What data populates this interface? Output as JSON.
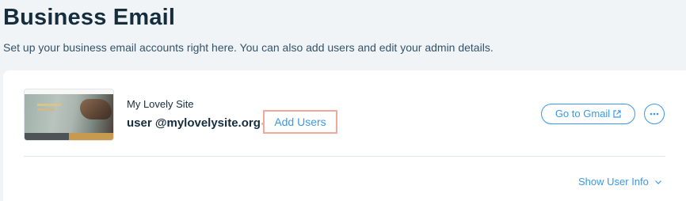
{
  "header": {
    "title": "Business Email",
    "subtitle": "Set up your business email accounts right here. You can also add users and edit your admin details."
  },
  "account": {
    "site_name": "My Lovely Site",
    "email": "user @mylovelysite.org",
    "add_users_label": "Add Users",
    "gmail_label": "Go to Gmail",
    "gmail_icon": "external-link-icon",
    "more_icon": "more-horizontal-icon",
    "show_user_info_label": "Show User Info",
    "show_user_info_icon": "chevron-down-icon"
  },
  "colors": {
    "accent": "#3899ec",
    "title": "#162d3d",
    "highlight_border": "#f3a99a",
    "background": "#f0f4f7"
  }
}
